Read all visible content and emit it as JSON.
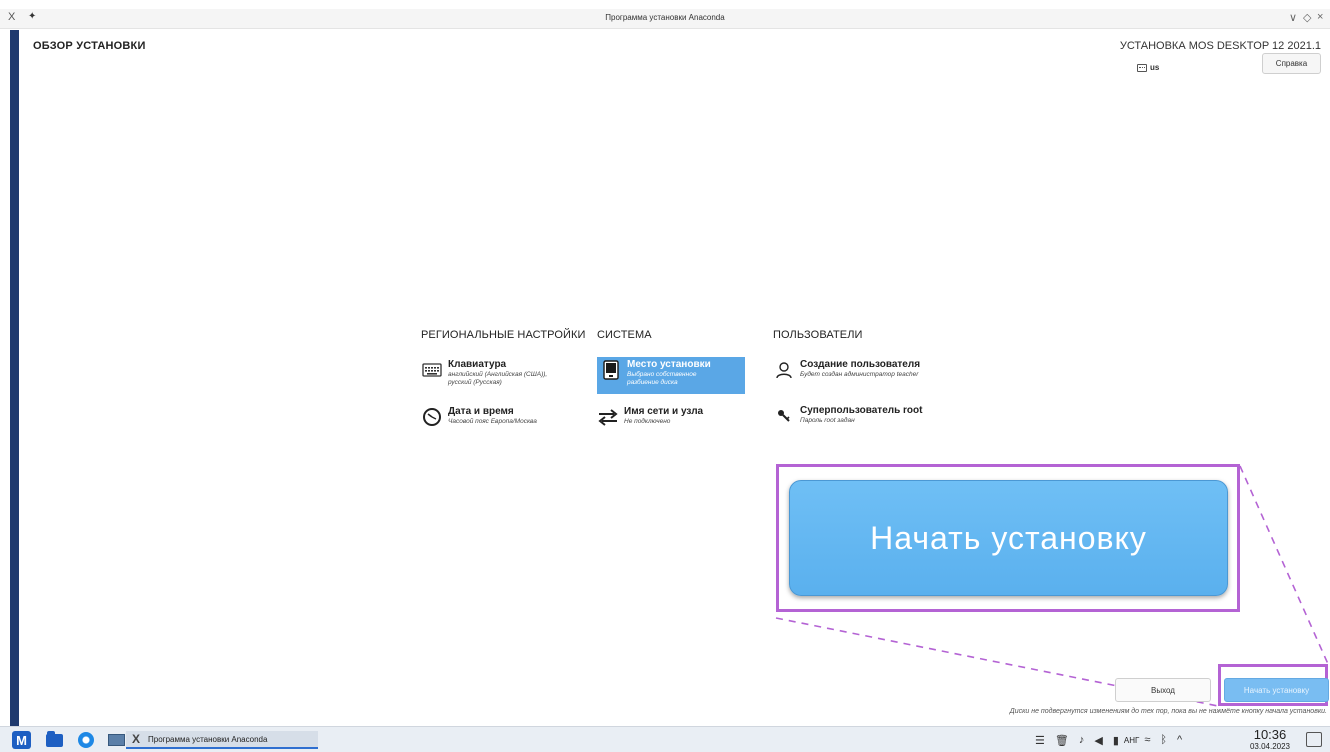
{
  "window": {
    "title": "Программа установки Anaconda",
    "pin_icon": "✦",
    "app_icon": "X",
    "controls": [
      "∨",
      "◇",
      "×"
    ]
  },
  "header": {
    "page_title": "ОБЗОР УСТАНОВКИ",
    "product_title": "УСТАНОВКА MOS DESKTOP 12 2021.1",
    "keyboard_layout": "us",
    "help_label": "Справка"
  },
  "hub": {
    "categories": [
      "РЕГИОНАЛЬНЫЕ НАСТРОЙКИ",
      "СИСТЕМА",
      "ПОЛЬЗОВАТЕЛИ"
    ],
    "spokes": {
      "keyboard": {
        "name": "Клавиатура",
        "status": "английский (Английская (США)), русский (Русская)",
        "icon": "keyboard-icon"
      },
      "datetime": {
        "name": "Дата и время",
        "status": "Часовой пояс Европа/Москва",
        "icon": "clock-icon"
      },
      "storage": {
        "name": "Место установки",
        "status": "Выбрано собственное разбиение диска",
        "icon": "disk-icon",
        "selected": true
      },
      "network": {
        "name": "Имя сети и узла",
        "status": "Не подключено",
        "icon": "network-arrows-icon"
      },
      "user": {
        "name": "Создание пользователя",
        "status": "Будет создан администратор teacher",
        "icon": "user-icon"
      },
      "root": {
        "name": "Суперпользователь root",
        "status": "Пароль root задан",
        "icon": "key-icon"
      }
    }
  },
  "callout": {
    "label": "Начать установку",
    "accent": "#b463d4",
    "button_color": "#5ab0ee"
  },
  "footer": {
    "quit_label": "Выход",
    "begin_label": "Начать установку",
    "warning": "Диски не подвергнутся изменениям до тех пор, пока вы не нажмёте кнопку начала установки."
  },
  "taskbar": {
    "start_label": "M",
    "task_label": "Программа установки Anaconda",
    "language": "АНГ",
    "time": "10:36",
    "date": "03.04.2023"
  }
}
